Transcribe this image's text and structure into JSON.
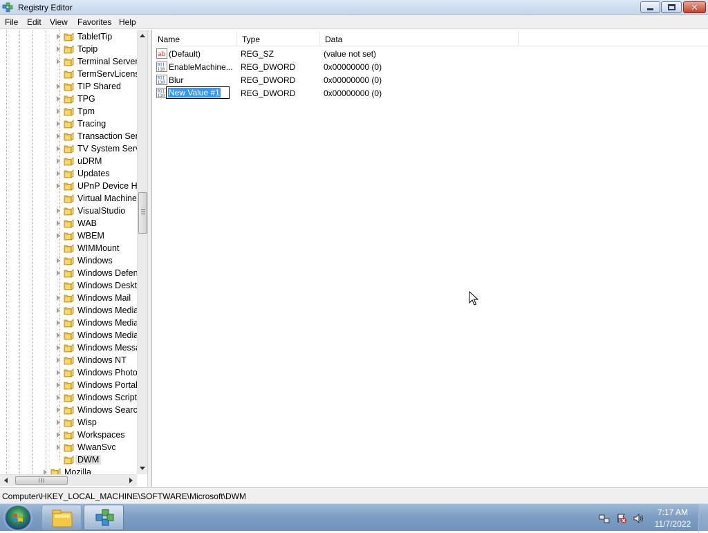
{
  "window": {
    "title": "Registry Editor"
  },
  "menu": [
    "File",
    "Edit",
    "View",
    "Favorites",
    "Help"
  ],
  "tree": {
    "items": [
      {
        "label": "TabletTip",
        "expandable": true
      },
      {
        "label": "Tcpip",
        "expandable": true
      },
      {
        "label": "Terminal Server",
        "expandable": true
      },
      {
        "label": "TermServLicens",
        "expandable": false
      },
      {
        "label": "TIP Shared",
        "expandable": true
      },
      {
        "label": "TPG",
        "expandable": true
      },
      {
        "label": "Tpm",
        "expandable": true
      },
      {
        "label": "Tracing",
        "expandable": true
      },
      {
        "label": "Transaction Serv",
        "expandable": true
      },
      {
        "label": "TV System Servi",
        "expandable": true
      },
      {
        "label": "uDRM",
        "expandable": true
      },
      {
        "label": "Updates",
        "expandable": true
      },
      {
        "label": "UPnP Device Ho",
        "expandable": true
      },
      {
        "label": "Virtual Machine",
        "expandable": false
      },
      {
        "label": "VisualStudio",
        "expandable": true
      },
      {
        "label": "WAB",
        "expandable": true
      },
      {
        "label": "WBEM",
        "expandable": true
      },
      {
        "label": "WIMMount",
        "expandable": false
      },
      {
        "label": "Windows",
        "expandable": true
      },
      {
        "label": "Windows Defen",
        "expandable": true
      },
      {
        "label": "Windows Deskto",
        "expandable": false
      },
      {
        "label": "Windows Mail",
        "expandable": true
      },
      {
        "label": "Windows Media",
        "expandable": true
      },
      {
        "label": "Windows Media",
        "expandable": true
      },
      {
        "label": "Windows Media",
        "expandable": true
      },
      {
        "label": "Windows Messa",
        "expandable": true
      },
      {
        "label": "Windows NT",
        "expandable": true
      },
      {
        "label": "Windows Photo",
        "expandable": true
      },
      {
        "label": "Windows Portal",
        "expandable": true
      },
      {
        "label": "Windows Script",
        "expandable": true
      },
      {
        "label": "Windows Search",
        "expandable": true
      },
      {
        "label": "Wisp",
        "expandable": true
      },
      {
        "label": "Workspaces",
        "expandable": true
      },
      {
        "label": "WwanSvc",
        "expandable": true
      },
      {
        "label": "DWM",
        "expandable": false,
        "selected": true
      }
    ],
    "parent_item": {
      "label": "Mozilla",
      "expandable": true
    }
  },
  "list": {
    "columns": {
      "name": "Name",
      "type": "Type",
      "data": "Data"
    },
    "rows": [
      {
        "icon": "string-value-icon",
        "name": "(Default)",
        "type": "REG_SZ",
        "data": "(value not set)"
      },
      {
        "icon": "dword-value-icon",
        "name": "EnableMachine...",
        "type": "REG_DWORD",
        "data": "0x00000000 (0)"
      },
      {
        "icon": "dword-value-icon",
        "name": "Blur",
        "type": "REG_DWORD",
        "data": "0x00000000 (0)"
      },
      {
        "icon": "dword-value-icon",
        "name": "New Value #1",
        "type": "REG_DWORD",
        "data": "0x00000000 (0)",
        "editing": true
      }
    ]
  },
  "status": {
    "path": "Computer\\HKEY_LOCAL_MACHINE\\SOFTWARE\\Microsoft\\DWM"
  },
  "taskbar": {
    "time": "7:17 AM",
    "date": "11/7/2022"
  },
  "colors": {
    "folder": "#e8b93a",
    "selection": "#3399ff",
    "taskbar": "#7e9fc4"
  }
}
